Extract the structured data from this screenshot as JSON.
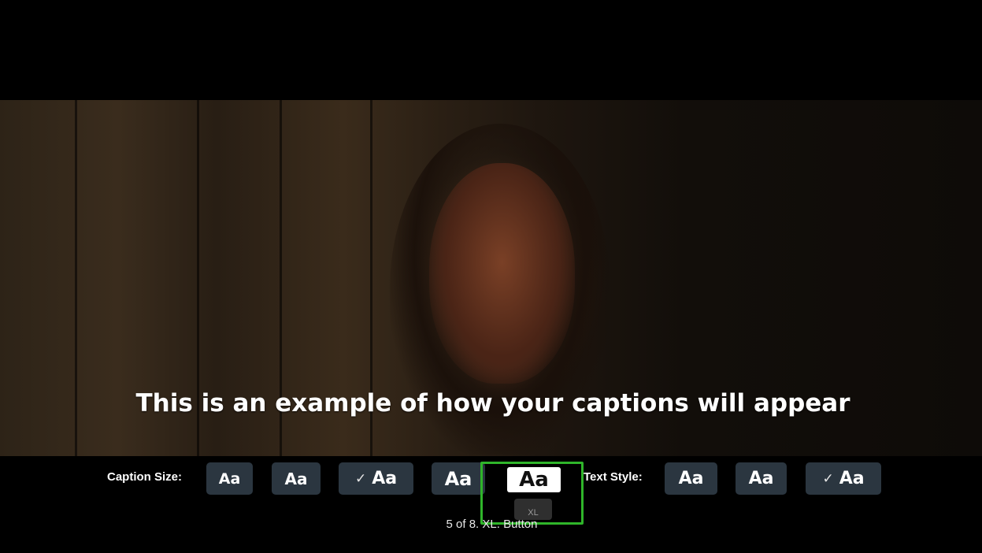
{
  "caption_preview": {
    "text": "This is an example of how your captions will appear"
  },
  "caption_size": {
    "label": "Caption Size:",
    "options": [
      {
        "text": "Aa",
        "checked": false
      },
      {
        "text": "Aa",
        "checked": false
      },
      {
        "text": "Aa",
        "checked": true,
        "check_glyph": "✓"
      },
      {
        "text": "Aa",
        "checked": false
      },
      {
        "text": "Aa",
        "checked": false,
        "focused": true,
        "tooltip": "XL"
      }
    ]
  },
  "text_style": {
    "label": "Text Style:",
    "options": [
      {
        "text": "Aa",
        "checked": false
      },
      {
        "text": "Aa",
        "checked": false
      },
      {
        "text": "Aa",
        "checked": true,
        "check_glyph": "✓"
      }
    ]
  },
  "accessibility_announcement": "5 of 8. XL. Button",
  "colors": {
    "focus_ring": "#2fb52a",
    "option_bg": "#2b3640",
    "focused_bg": "#ffffff"
  },
  "icons": {
    "check": "check-icon"
  }
}
